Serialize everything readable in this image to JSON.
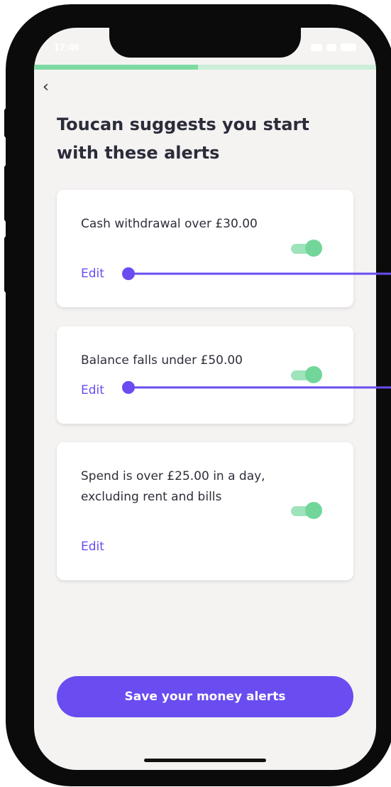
{
  "status_bar": {
    "time": "17:46"
  },
  "navigation": {
    "back_icon": "chevron-left-icon",
    "back_glyph": "‹"
  },
  "onboarding": {
    "progress": 0.5
  },
  "page": {
    "title": "Toucan suggests you start with these alerts"
  },
  "alerts": [
    {
      "text": "Cash withdrawal over £30.00",
      "edit_label": "Edit",
      "enabled": true
    },
    {
      "text": "Balance falls under £50.00",
      "edit_label": "Edit",
      "enabled": true
    },
    {
      "text": "Spend is over £25.00 in a day, excluding rent and bills",
      "edit_label": "Edit",
      "enabled": true
    }
  ],
  "actions": {
    "save_label": "Save your money alerts"
  },
  "colors": {
    "accent": "#6a4cf0",
    "toggle_on": "#72d69a",
    "progress": "#7ddaa2",
    "background": "#f4f3f2",
    "text": "#2c2c3a"
  }
}
